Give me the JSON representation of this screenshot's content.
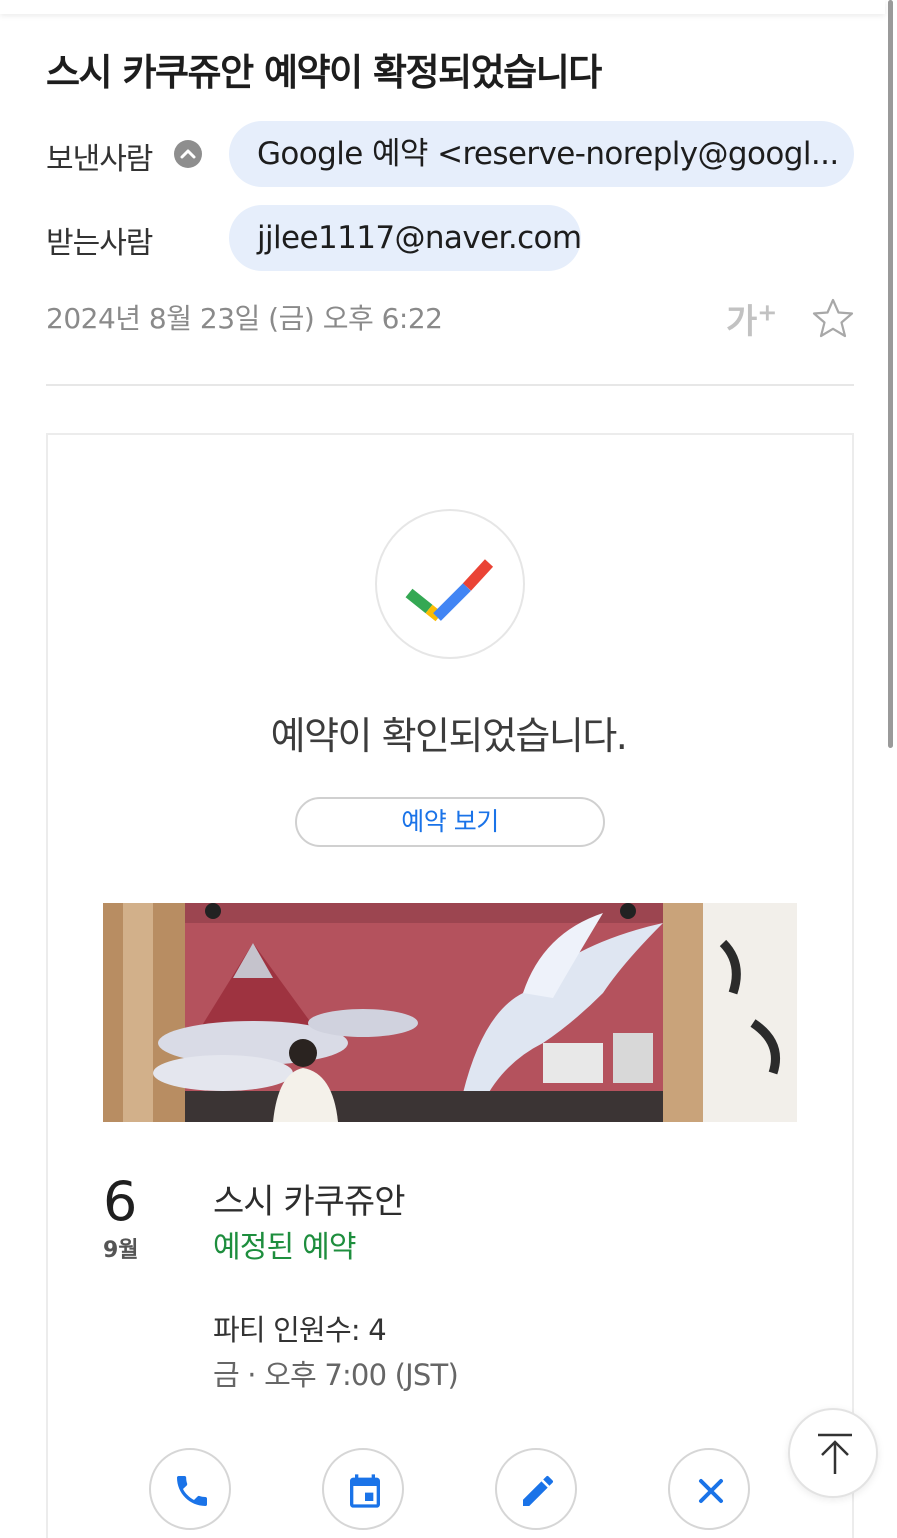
{
  "email": {
    "subject": "스시 카쿠쥬안 예약이 확정되었습니다",
    "sender_label": "보낸사람",
    "sender": "Google 예약 <reserve-noreply@googl...",
    "recipient_label": "받는사람",
    "recipient": "jjlee1117@naver.com",
    "date": "2024년 8월 23일 (금) 오후 6:22",
    "font_size_control": "가",
    "font_size_plus": "+"
  },
  "reservation": {
    "confirmed_text": "예약이 확인되었습니다.",
    "view_button": "예약 보기",
    "day": "6",
    "month": "9월",
    "restaurant": "스시 카쿠쥬안",
    "status": "예정된 예약",
    "party_size": "파티 인원수: 4",
    "time": "금 · 오후 7:00 (JST)"
  },
  "actions": [
    {
      "icon": "phone-icon"
    },
    {
      "icon": "calendar-icon"
    },
    {
      "icon": "edit-icon"
    },
    {
      "icon": "close-icon"
    }
  ],
  "colors": {
    "accent": "#1a73e8",
    "status_green": "#1e8e3e",
    "chip_bg": "#e6eefb"
  }
}
